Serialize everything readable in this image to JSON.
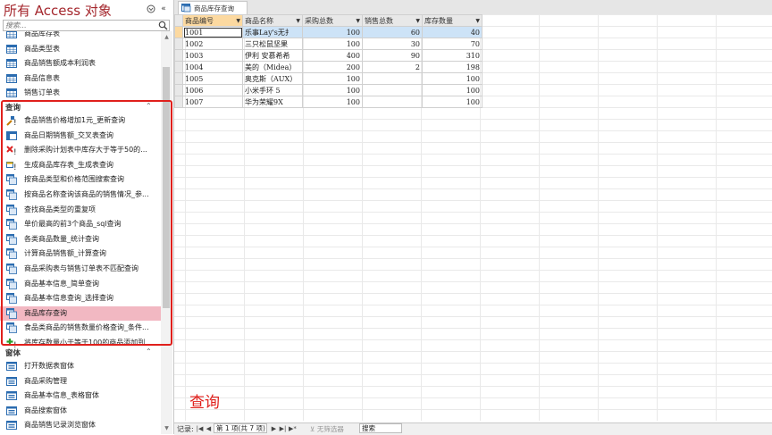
{
  "nav": {
    "title": "所有 Access 对象",
    "search_placeholder": "搜索...",
    "tables_partial": [
      {
        "label": "商品库存表",
        "icon": "table-icon"
      },
      {
        "label": "商品类型表",
        "icon": "table-icon"
      },
      {
        "label": "商品销售额成本利润表",
        "icon": "table-icon"
      },
      {
        "label": "商品信息表",
        "icon": "table-icon"
      },
      {
        "label": "销售订单表",
        "icon": "table-icon"
      }
    ],
    "groups": {
      "queries": "查询",
      "forms": "窗体"
    },
    "queries": [
      {
        "label": "食品销售价格增加1元_更新查询",
        "icon": "update-query-icon"
      },
      {
        "label": "商品日期销售额_交叉表查询",
        "icon": "crosstab-query-icon"
      },
      {
        "label": "删除采购计划表中库存大于等于50的...",
        "icon": "delete-query-icon"
      },
      {
        "label": "生成商品库存表_生成表查询",
        "icon": "make-table-query-icon"
      },
      {
        "label": "按商品类型和价格范围搜索查询",
        "icon": "select-query-icon"
      },
      {
        "label": "按商品名称查询该商品的销售情况_参...",
        "icon": "select-query-icon"
      },
      {
        "label": "查找商品类型的重复项",
        "icon": "select-query-icon"
      },
      {
        "label": "单价最高的前3个商品_sql查询",
        "icon": "select-query-icon"
      },
      {
        "label": "各类商品数量_统计查询",
        "icon": "select-query-icon"
      },
      {
        "label": "计算商品销售额_计算查询",
        "icon": "select-query-icon"
      },
      {
        "label": "商品采购表与销售订单表不匹配查询",
        "icon": "select-query-icon"
      },
      {
        "label": "商品基本信息_简单查询",
        "icon": "select-query-icon"
      },
      {
        "label": "商品基本信息查询_选择查询",
        "icon": "select-query-icon"
      },
      {
        "label": "商品库存查询",
        "icon": "select-query-icon",
        "selected": true
      },
      {
        "label": "食品类商品的销售数量价格查询_条件...",
        "icon": "select-query-icon"
      },
      {
        "label": "将库存数量小于等于100的商品添加到...",
        "icon": "append-query-icon"
      }
    ],
    "forms": [
      {
        "label": "打开数据表窗体",
        "icon": "form-icon"
      },
      {
        "label": "商品采购管理",
        "icon": "form-icon"
      },
      {
        "label": "商品基本信息_表格窗体",
        "icon": "form-icon"
      },
      {
        "label": "商品搜索窗体",
        "icon": "form-icon"
      },
      {
        "label": "商品销售记录浏览窗体",
        "icon": "form-icon"
      }
    ]
  },
  "tab": {
    "label": "商品库存查询"
  },
  "datasheet": {
    "columns": [
      "商品编号",
      "商品名称",
      "采购总数",
      "销售总数",
      "库存数量"
    ],
    "rows": [
      [
        "1001",
        "乐事Lay's无扌",
        "100",
        "60",
        "40"
      ],
      [
        "1002",
        "三只松鼠坚果",
        "100",
        "30",
        "70"
      ],
      [
        "1003",
        "伊利 安慕希希",
        "400",
        "90",
        "310"
      ],
      [
        "1004",
        "美的（Midea）",
        "200",
        "2",
        "198"
      ],
      [
        "1005",
        "奥克斯（AUX）",
        "100",
        "",
        "100"
      ],
      [
        "1006",
        "小米手环 5",
        "100",
        "",
        "100"
      ],
      [
        "1007",
        "华为荣耀9X",
        "100",
        "",
        "100"
      ]
    ]
  },
  "overlay_text": "查询",
  "status": {
    "record_label": "记录:",
    "record_value": "第 1 项(共 7 项)",
    "filter_label": "无筛选器",
    "search_label": "搜索"
  },
  "colors": {
    "accent_red": "#e0201c",
    "title_red": "#a4262c",
    "selected_bg": "#f2b8c2"
  }
}
